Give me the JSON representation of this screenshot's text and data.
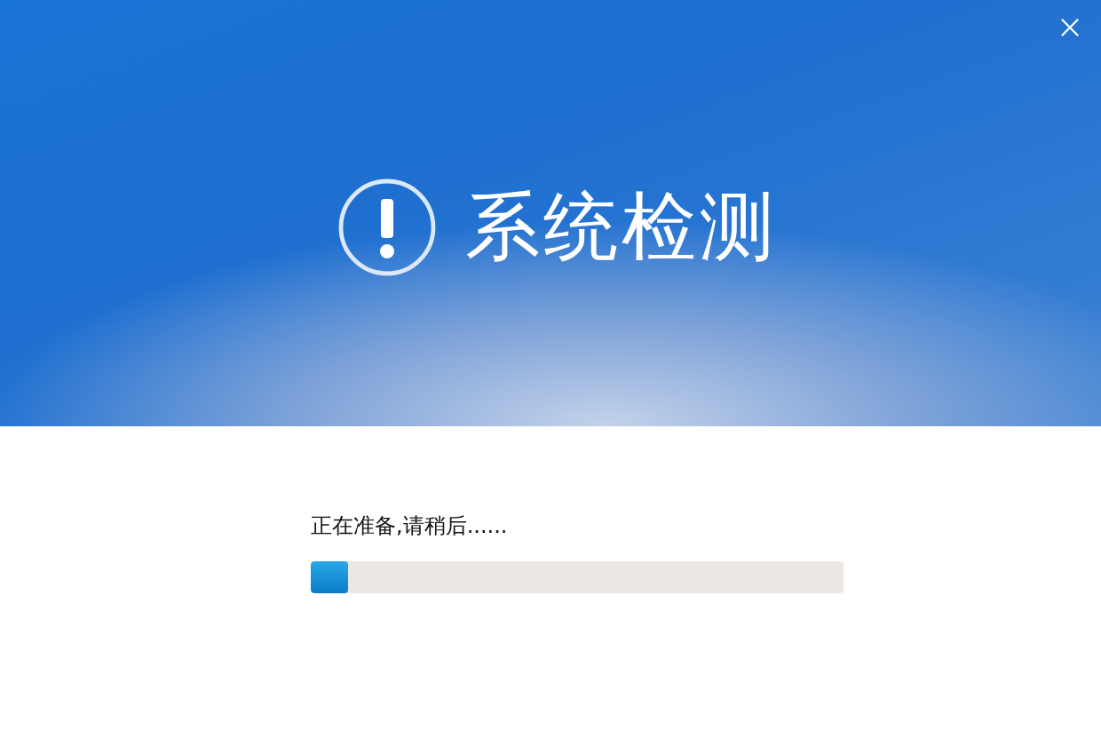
{
  "header": {
    "title": "系统检测"
  },
  "progress": {
    "label": "正在准备,请稍后......",
    "level": 0.07
  }
}
